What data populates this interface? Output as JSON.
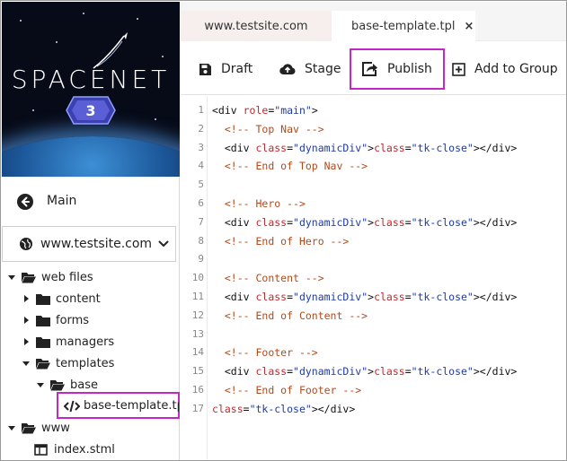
{
  "sidebar": {
    "logo_text": "SPACENET",
    "logo_badge": "3",
    "main_label": "Main",
    "site_select": {
      "value": "www.testsite.com"
    },
    "tree": [
      {
        "label": "web files",
        "type": "folder",
        "expanded": true,
        "level": 0
      },
      {
        "label": "content",
        "type": "folder",
        "expanded": false,
        "level": 1
      },
      {
        "label": "forms",
        "type": "folder",
        "expanded": false,
        "level": 1
      },
      {
        "label": "managers",
        "type": "folder",
        "expanded": false,
        "level": 1
      },
      {
        "label": "templates",
        "type": "folder",
        "expanded": true,
        "level": 1
      },
      {
        "label": "base",
        "type": "folder",
        "expanded": true,
        "level": 2
      },
      {
        "label": "base-template.tpl",
        "type": "code-file",
        "selected": true,
        "level": 3
      },
      {
        "label": "www",
        "type": "folder",
        "expanded": true,
        "level": 0
      },
      {
        "label": "index.stml",
        "type": "page-file",
        "level": 1
      }
    ]
  },
  "tabs": [
    {
      "label": "www.testsite.com",
      "active": false
    },
    {
      "label": "base-template.tpl",
      "active": true,
      "close": "×"
    }
  ],
  "toolbar": {
    "draft": "Draft",
    "stage": "Stage",
    "publish": "Publish",
    "add_to_group": "Add to Group"
  },
  "editor": {
    "lines": [
      "<div role=\"main\">",
      "  <!-- Top Nav -->",
      "  <div class=\"dynamicDiv\"></div>",
      "  <!-- End of Top Nav -->",
      "",
      "  <!-- Hero -->",
      "  <div class=\"dynamicDiv\"></div>",
      "  <!-- End of Hero -->",
      "",
      "  <!-- Content -->",
      "  <div class=\"dynamicDiv\"></div>",
      "  <!-- End of Content -->",
      "",
      "  <!-- Footer -->",
      "  <div class=\"dynamicDiv\"></div>",
      "  <!-- End of Footer -->",
      "</div>"
    ]
  },
  "colors": {
    "highlight": "#c227c9",
    "tab_inactive_bg": "#f7eeee",
    "comment": "#b24a1b",
    "attribute": "#c0282e",
    "string": "#1f3aa8"
  },
  "icons": {
    "back": "arrow-left-circle-icon",
    "site": "globe-icon",
    "folder": "folder-icon",
    "folder_open": "folder-open-icon",
    "code_file": "code-icon",
    "page_file": "window-icon",
    "draft": "floppy-disk-icon",
    "stage": "cloud-upload-icon",
    "publish": "share-icon",
    "add_to_group": "plus-square-icon"
  }
}
